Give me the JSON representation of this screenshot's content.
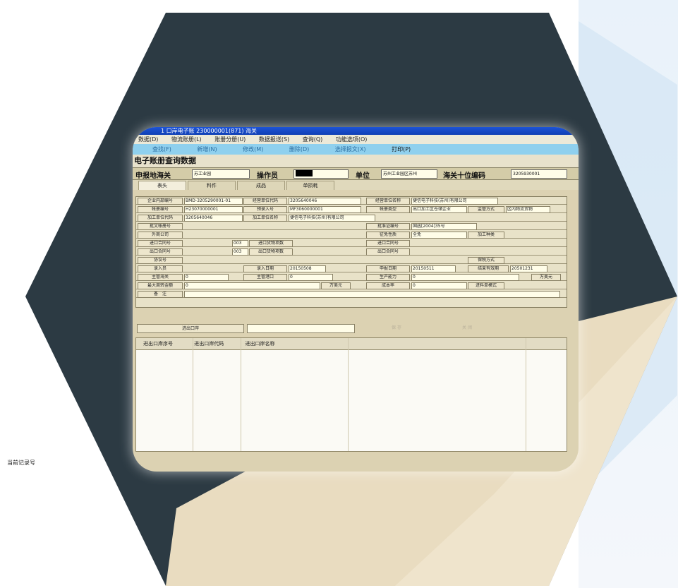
{
  "window": {
    "title": "1 口岸电子账 230000001(871) 海关",
    "menu": [
      "数据(D)",
      "物流账册(L)",
      "账册分册(U)",
      "数据报送(S)",
      "查询(Q)",
      "功能选项(O)"
    ],
    "toolbar": [
      "查找(F)",
      "新增(N)",
      "修改(M)",
      "删除(D)",
      "选择报文(X)",
      "打印(P)"
    ]
  },
  "panel": {
    "title": "电子账册查询数据",
    "customs_label": "申报地海关",
    "customs_value": "苏工业园",
    "operator_label": "操作员",
    "unit_label": "单位",
    "unit_value": "苏州工业园区苏州",
    "code_label": "海关十位编码",
    "code_value": "3205930001"
  },
  "tabs": [
    "表头",
    "料件",
    "成品",
    "单损耗"
  ],
  "form": {
    "r1": [
      "企业内部编号",
      "BMD-3205290001-01",
      "经营单位代码",
      "3205640046",
      "经营单位名称",
      "捷信电子科技(苏州)有限公司"
    ],
    "r2": [
      "帐册编号",
      "H23070000001",
      "预录入号",
      "MF3060000001",
      "帐册类型",
      "出口加工区仓储企业",
      "监管方式",
      "区内物流货物"
    ],
    "r3": [
      "加工单位代码",
      "3205640046",
      "加工单位名称",
      "捷信电子科技(苏州)有限公司"
    ],
    "r4": [
      "批文帐册号",
      "批准证编号",
      "国函[2004]35号"
    ],
    "r5": [
      "外商公司",
      "征免性质",
      "全免",
      "加工种类"
    ],
    "r6": [
      "进口合同号",
      "003",
      "进口货物项数",
      "进口合同号"
    ],
    "r7": [
      "出口合同号",
      "003",
      "出口货物项数",
      "出口合同号"
    ],
    "r8": [
      "协议号",
      "保税方式"
    ],
    "r9": [
      "录入员",
      "录入日期",
      "20150508",
      "申报日期",
      "20150511",
      "结束有效期",
      "20501231"
    ],
    "r10": [
      "主管海关",
      "0",
      "主管港口",
      "0",
      "生产能力",
      "0",
      "万美元"
    ],
    "r11": [
      "最大周转金额",
      "0",
      "万美元",
      "成本率",
      "0",
      "进料单模式"
    ],
    "r12": [
      "备　注"
    ]
  },
  "entry": {
    "label": "进出口岸",
    "btn1": "保 存",
    "btn2": "关 闭"
  },
  "grid": {
    "columns": [
      "进出口岸序号",
      "进出口岸代码",
      "进出口岸名称"
    ]
  },
  "status": {
    "text": "当前记录号"
  }
}
